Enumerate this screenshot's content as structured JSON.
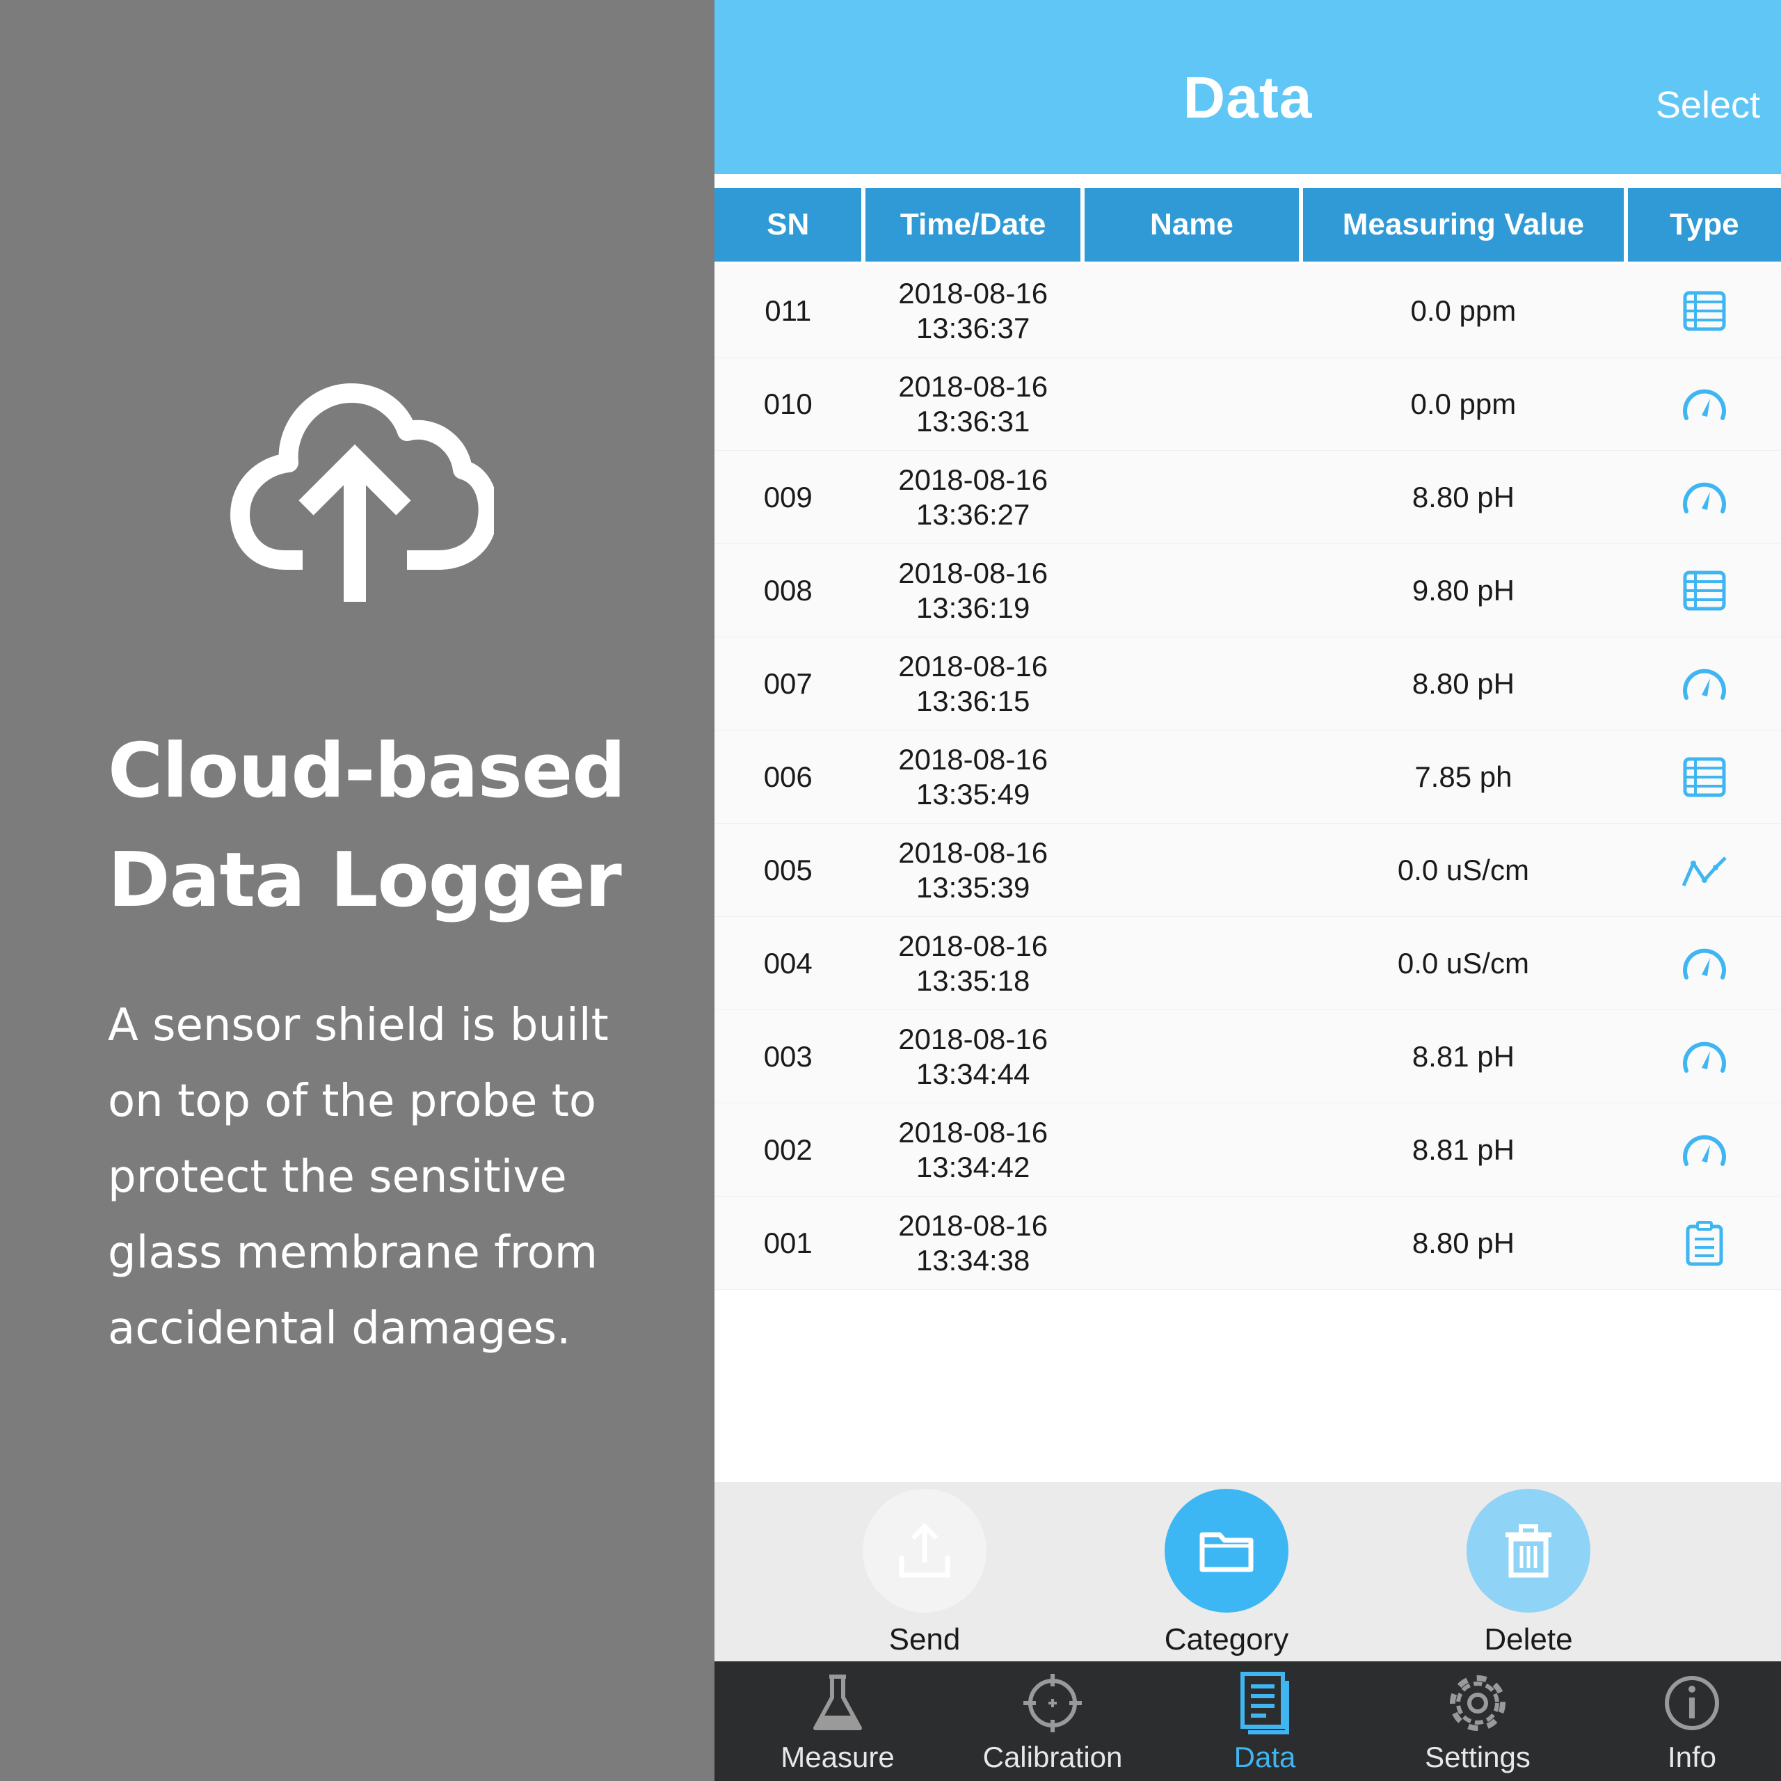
{
  "promo": {
    "title_lines": [
      "Cloud-based",
      "Data Logger"
    ],
    "body_lines": [
      "A sensor shield is built",
      "on top of the probe to",
      "protect the sensitive",
      "glass membrane from",
      "accidental damages."
    ],
    "icon": "cloud-upload-icon"
  },
  "navbar": {
    "title": "Data",
    "select_label": "Select"
  },
  "table": {
    "headers": {
      "sn": "SN",
      "time": "Time/Date",
      "name": "Name",
      "value": "Measuring Value",
      "type": "Type"
    },
    "rows": [
      {
        "sn": "011",
        "date": "2018-08-16",
        "time": "13:36:37",
        "name": "",
        "value": "0.0 ppm",
        "type": "table-icon"
      },
      {
        "sn": "010",
        "date": "2018-08-16",
        "time": "13:36:31",
        "name": "",
        "value": "0.0 ppm",
        "type": "gauge-icon"
      },
      {
        "sn": "009",
        "date": "2018-08-16",
        "time": "13:36:27",
        "name": "",
        "value": "8.80 pH",
        "type": "gauge-icon"
      },
      {
        "sn": "008",
        "date": "2018-08-16",
        "time": "13:36:19",
        "name": "",
        "value": "9.80 pH",
        "type": "table-icon"
      },
      {
        "sn": "007",
        "date": "2018-08-16",
        "time": "13:36:15",
        "name": "",
        "value": "8.80 pH",
        "type": "gauge-icon"
      },
      {
        "sn": "006",
        "date": "2018-08-16",
        "time": "13:35:49",
        "name": "",
        "value": "7.85 ph",
        "type": "table-icon"
      },
      {
        "sn": "005",
        "date": "2018-08-16",
        "time": "13:35:39",
        "name": "",
        "value": "0.0 uS/cm",
        "type": "line-chart-icon"
      },
      {
        "sn": "004",
        "date": "2018-08-16",
        "time": "13:35:18",
        "name": "",
        "value": "0.0 uS/cm",
        "type": "gauge-icon"
      },
      {
        "sn": "003",
        "date": "2018-08-16",
        "time": "13:34:44",
        "name": "",
        "value": "8.81 pH",
        "type": "gauge-icon"
      },
      {
        "sn": "002",
        "date": "2018-08-16",
        "time": "13:34:42",
        "name": "",
        "value": "8.81 pH",
        "type": "gauge-icon"
      },
      {
        "sn": "001",
        "date": "2018-08-16",
        "time": "13:34:38",
        "name": "",
        "value": "8.80 pH",
        "type": "clipboard-icon"
      }
    ]
  },
  "actions": {
    "send": {
      "label": "Send",
      "icon": "upload-icon"
    },
    "category": {
      "label": "Category",
      "icon": "folder-icon"
    },
    "delete": {
      "label": "Delete",
      "icon": "trash-icon"
    }
  },
  "tabs": [
    {
      "key": "measure",
      "label": "Measure",
      "icon": "flask-icon",
      "active": false
    },
    {
      "key": "calibration",
      "label": "Calibration",
      "icon": "crosshair-icon",
      "active": false
    },
    {
      "key": "data",
      "label": "Data",
      "icon": "document-icon",
      "active": true
    },
    {
      "key": "settings",
      "label": "Settings",
      "icon": "gear-icon",
      "active": false
    },
    {
      "key": "info",
      "label": "Info",
      "icon": "info-icon",
      "active": false
    }
  ],
  "colors": {
    "navbar": "#5fc6f6",
    "header": "#2f9ad6",
    "accent": "#3fb6f2",
    "promo_bg": "#7c7c7c",
    "tabbar": "#2c2d2f"
  }
}
